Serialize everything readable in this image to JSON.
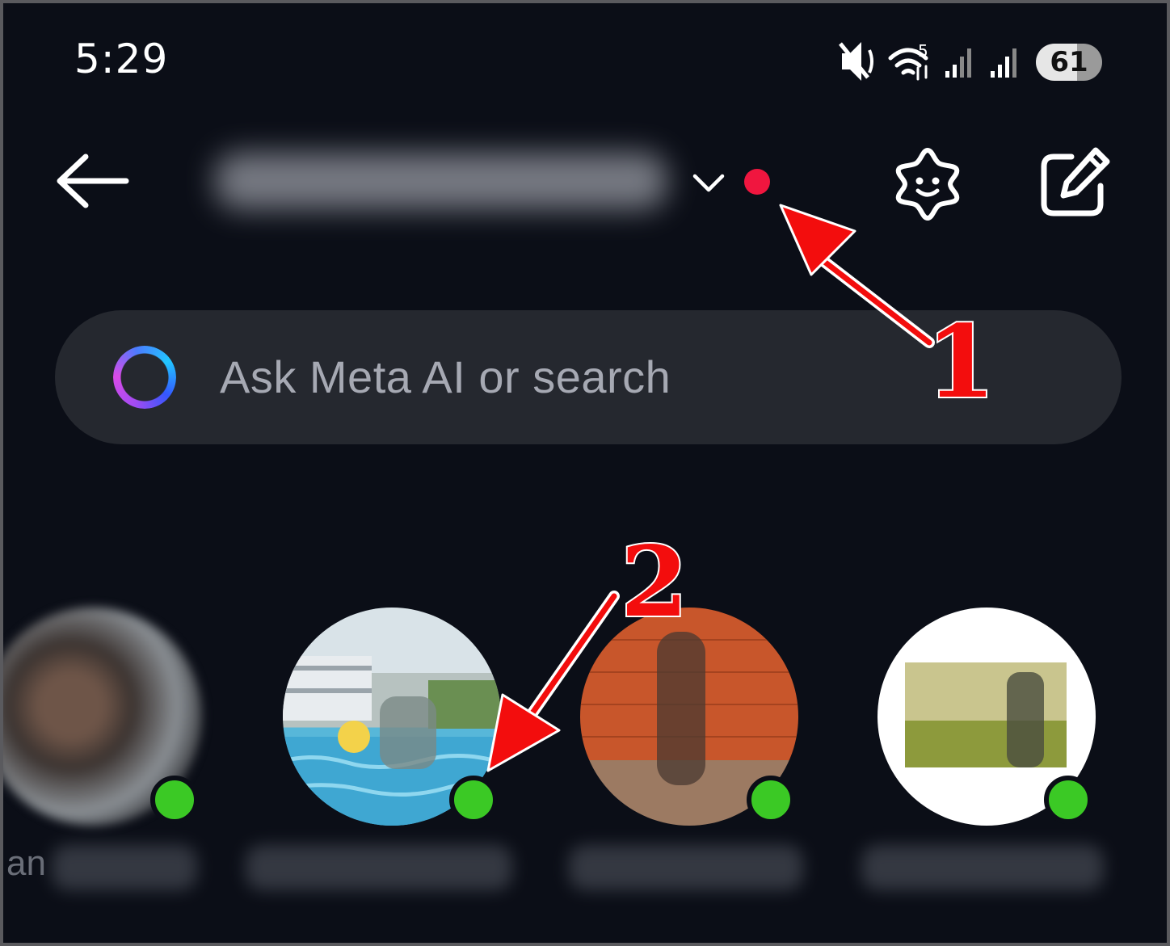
{
  "status_bar": {
    "time": "5:29",
    "battery": "61",
    "icons": [
      "mute-icon",
      "wifi-icon",
      "signal-icon",
      "signal-icon",
      "battery-icon"
    ]
  },
  "header": {
    "back_icon": "back-arrow-icon",
    "dropdown_icon": "chevron-down-icon",
    "notification_color": "#f0163f",
    "meta_ai_icon": "meta-ai-sparkle-face-icon",
    "compose_icon": "compose-edit-icon"
  },
  "search": {
    "icon": "meta-ai-ring-icon",
    "placeholder": "Ask Meta AI or search"
  },
  "contacts": {
    "online_color": "#3bc925",
    "partial_label_fragment": "an"
  },
  "annotations": {
    "marker_1": "1",
    "marker_2": "2",
    "arrow_color": "#f30d0d"
  }
}
